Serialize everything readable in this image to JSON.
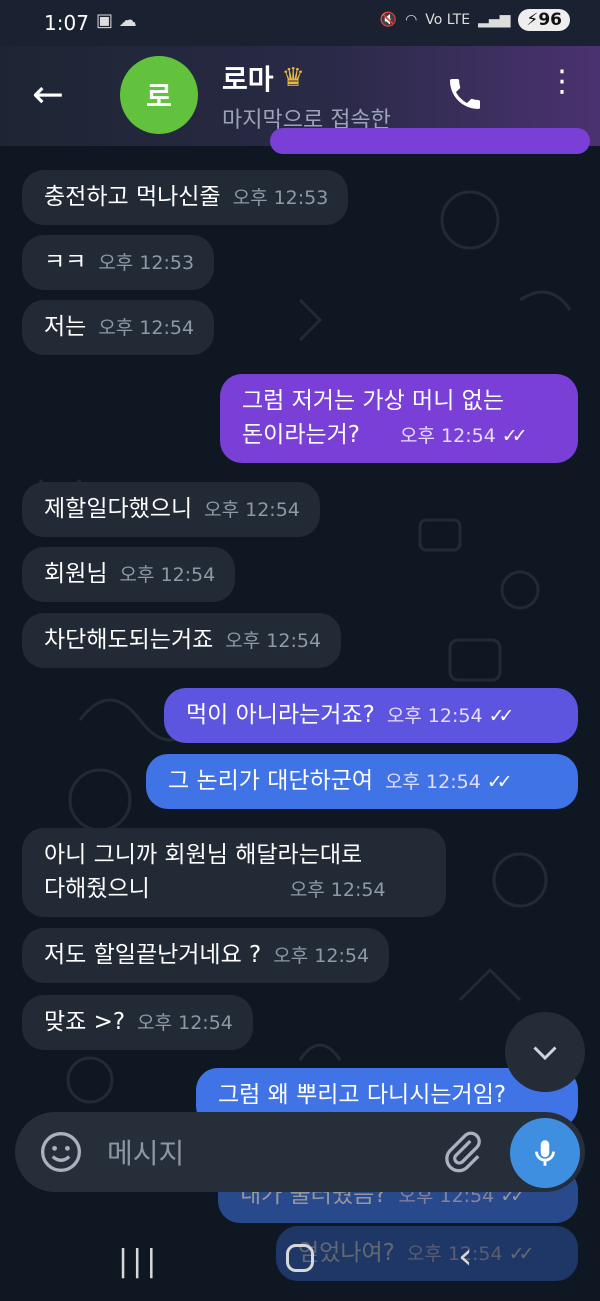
{
  "status_bar": {
    "time": "1:07",
    "battery": "96",
    "network": "Vo LTE"
  },
  "header": {
    "contact_name": "로마",
    "contact_initial": "로",
    "status": "마지막으로 접속한"
  },
  "messages": [
    {
      "dir": "in",
      "text": "충전하고 먹나신줄",
      "time": "오후 12:53"
    },
    {
      "dir": "in",
      "text": "ㅋㅋ",
      "time": "오후 12:53"
    },
    {
      "dir": "in",
      "text": "저는",
      "time": "오후 12:54"
    },
    {
      "dir": "out",
      "text": "그럼 저거는 가상 머니 없는",
      "text2": "돈이라는거?",
      "time": "오후 12:54"
    },
    {
      "dir": "in",
      "text": "제할일다했으니",
      "time": "오후 12:54"
    },
    {
      "dir": "in",
      "text": "회원님",
      "time": "오후 12:54"
    },
    {
      "dir": "in",
      "text": "차단해도되는거죠",
      "time": "오후 12:54"
    },
    {
      "dir": "out",
      "text": "먹이 아니라는거죠?",
      "time": "오후 12:54"
    },
    {
      "dir": "out",
      "text": "그 논리가 대단하군여",
      "time": "오후 12:54"
    },
    {
      "dir": "in",
      "text": "아니 그니까 회원님 해달라는대로",
      "text2": "다해줬으니",
      "time": "오후 12:54"
    },
    {
      "dir": "in",
      "text": "저도 할일끝난거네요 ?",
      "time": "오후 12:54"
    },
    {
      "dir": "in",
      "text": "맞죠 >?",
      "time": "오후 12:54"
    },
    {
      "dir": "out",
      "text": "그럼 왜 뿌리고 다니시는거임?"
    },
    {
      "dir": "out",
      "text": "내가 불러줬음?",
      "time": "오후 12:54"
    },
    {
      "dir": "out",
      "text": "얻었나여?",
      "time": "오후 12:54"
    }
  ],
  "input": {
    "placeholder": "메시지"
  },
  "colors": {
    "purple": "#7a3fd6",
    "indigo": "#5d55e0",
    "blue": "#3f73e6",
    "incoming": "#222a35"
  }
}
